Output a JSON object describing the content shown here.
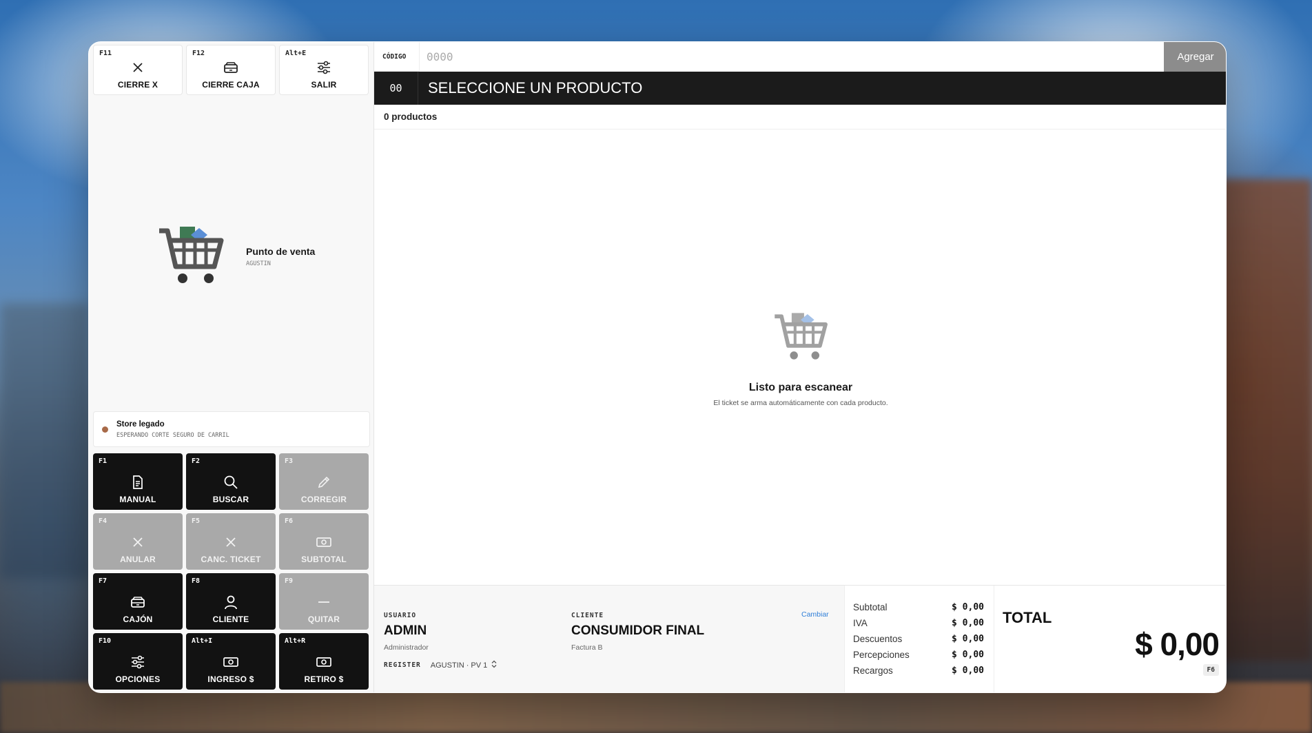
{
  "top_actions": [
    {
      "key": "F11",
      "label": "CIERRE X",
      "icon": "close-icon"
    },
    {
      "key": "F12",
      "label": "CIERRE CAJA",
      "icon": "drawer-icon"
    },
    {
      "key": "Alt+E",
      "label": "SALIR",
      "icon": "sliders-icon"
    }
  ],
  "brand": {
    "title": "Punto de venta",
    "subtitle": "AGUSTIN"
  },
  "status": {
    "title": "Store legado",
    "detail": "ESPERANDO CORTE SEGURO DE CARRIL",
    "dot_color": "#a86a48"
  },
  "function_keys": [
    {
      "key": "F1",
      "label": "MANUAL",
      "icon": "document-icon",
      "style": "dark"
    },
    {
      "key": "F2",
      "label": "BUSCAR",
      "icon": "search-icon",
      "style": "dark"
    },
    {
      "key": "F3",
      "label": "CORREGIR",
      "icon": "pencil-icon",
      "style": "gray"
    },
    {
      "key": "F4",
      "label": "ANULAR",
      "icon": "close-icon",
      "style": "gray"
    },
    {
      "key": "F5",
      "label": "CANC. TICKET",
      "icon": "close-icon",
      "style": "gray"
    },
    {
      "key": "F6",
      "label": "SUBTOTAL",
      "icon": "cash-icon",
      "style": "gray"
    },
    {
      "key": "F7",
      "label": "CAJÓN",
      "icon": "drawer-icon",
      "style": "dark"
    },
    {
      "key": "F8",
      "label": "CLIENTE",
      "icon": "user-icon",
      "style": "dark"
    },
    {
      "key": "F9",
      "label": "QUITAR",
      "icon": "minus-icon",
      "style": "gray"
    },
    {
      "key": "F10",
      "label": "OPCIONES",
      "icon": "sliders-icon",
      "style": "dark"
    },
    {
      "key": "Alt+I",
      "label": "INGRESO $",
      "icon": "cash-icon",
      "style": "dark"
    },
    {
      "key": "Alt+R",
      "label": "RETIRO $",
      "icon": "cash-icon",
      "style": "dark"
    }
  ],
  "code_bar": {
    "label": "CÓDIGO",
    "placeholder": "0000",
    "value": "",
    "add_label": "Agregar"
  },
  "product_bar": {
    "qty": "00",
    "name": "SELECCIONE UN PRODUCTO"
  },
  "ticket": {
    "count_text": "0 productos"
  },
  "empty_state": {
    "title": "Listo para escanear",
    "message": "El ticket se arma automáticamente con cada producto."
  },
  "footer": {
    "user_label": "USUARIO",
    "user_name": "ADMIN",
    "user_role": "Administrador",
    "client_label": "CLIENTE",
    "client_name": "CONSUMIDOR FINAL",
    "client_invoice": "Factura B",
    "change_label": "Cambiar",
    "register_label": "REGISTER",
    "register_value": "AGUSTIN · PV 1"
  },
  "summary": [
    {
      "label": "Subtotal",
      "value": "$ 0,00"
    },
    {
      "label": "IVA",
      "value": "$ 0,00"
    },
    {
      "label": "Descuentos",
      "value": "$ 0,00"
    },
    {
      "label": "Percepciones",
      "value": "$ 0,00"
    },
    {
      "label": "Recargos",
      "value": "$ 0,00"
    }
  ],
  "total": {
    "label": "TOTAL",
    "value": "$ 0,00",
    "key": "F6"
  },
  "colors": {
    "accent_dark": "#121212",
    "disabled_gray": "#a9a9a9",
    "link_blue": "#2f7fd8",
    "add_button": "#8c8c8c"
  }
}
